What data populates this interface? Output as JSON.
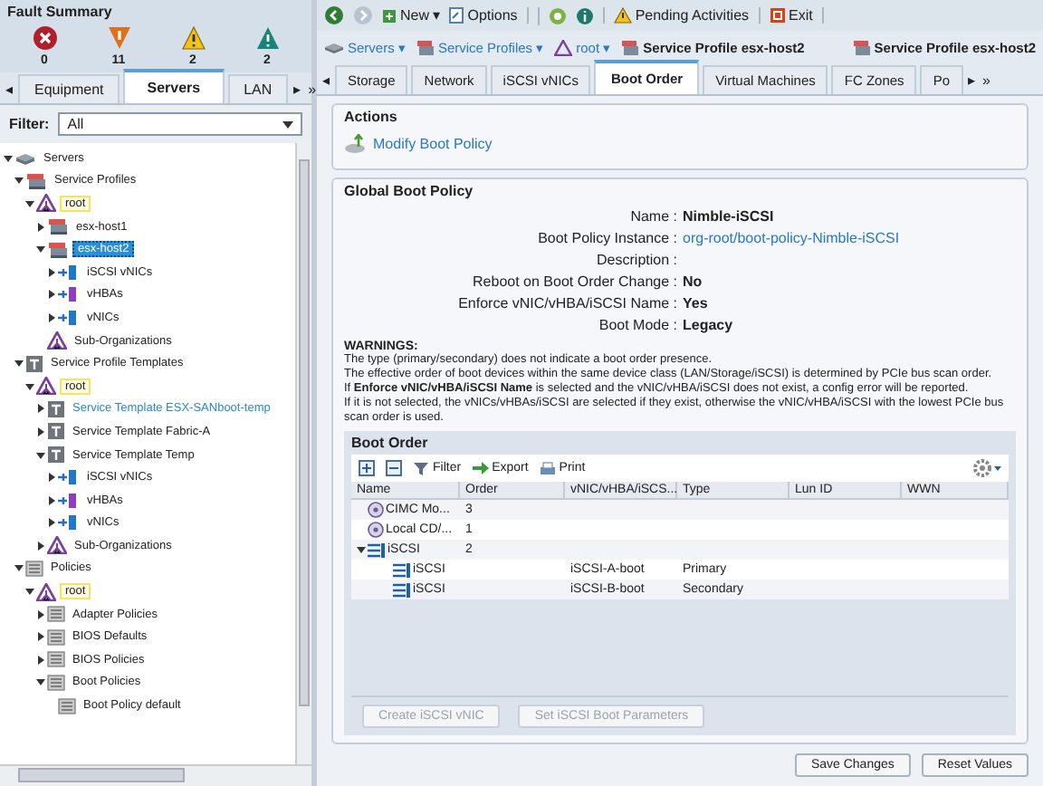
{
  "fault_summary": {
    "title": "Fault Summary",
    "faults": [
      {
        "kind": "critical",
        "count": "0"
      },
      {
        "kind": "major",
        "count": "11"
      },
      {
        "kind": "minor",
        "count": "2"
      },
      {
        "kind": "warning",
        "count": "2"
      }
    ]
  },
  "nav_tabs": {
    "prev": "◂",
    "next": "▸",
    "more": "»",
    "tabs": [
      {
        "label": "Equipment",
        "selected": false
      },
      {
        "label": "Servers",
        "selected": true
      },
      {
        "label": "LAN",
        "selected": false
      }
    ]
  },
  "filter": {
    "label": "Filter:",
    "value": "All"
  },
  "tree": [
    {
      "label": "Servers",
      "kind": "server",
      "expanded": true,
      "selected": false,
      "hovered": false,
      "children": [
        {
          "label": "Service Profiles",
          "kind": "profiles",
          "expanded": true,
          "selected": false,
          "hovered": false,
          "children": [
            {
              "label": "root",
              "kind": "root",
              "expanded": true,
              "selected": false,
              "hovered": false,
              "children": [
                {
                  "label": "esx-host1",
                  "kind": "host",
                  "expanded": false,
                  "selected": false,
                  "hovered": false
                },
                {
                  "label": "esx-host2",
                  "kind": "host",
                  "expanded": true,
                  "selected": true,
                  "hovered": false,
                  "children": [
                    {
                      "label": "iSCSI vNICs",
                      "kind": "vnic",
                      "expanded": false,
                      "selected": false,
                      "hovered": false
                    },
                    {
                      "label": "vHBAs",
                      "kind": "vhba",
                      "expanded": false,
                      "selected": false,
                      "hovered": false
                    },
                    {
                      "label": "vNICs",
                      "kind": "vnic",
                      "expanded": false,
                      "selected": false,
                      "hovered": false
                    }
                  ]
                },
                {
                  "label": "Sub-Organizations",
                  "kind": "org",
                  "selected": false,
                  "hovered": false
                }
              ]
            }
          ]
        },
        {
          "label": "Service Profile Templates",
          "kind": "template",
          "expanded": true,
          "selected": false,
          "hovered": false,
          "children": [
            {
              "label": "root",
              "kind": "root",
              "expanded": true,
              "selected": false,
              "hovered": false,
              "children": [
                {
                  "label": "Service Template ESX-SANboot-temp",
                  "kind": "template",
                  "expanded": false,
                  "selected": false,
                  "hovered": true
                },
                {
                  "label": "Service Template Fabric-A",
                  "kind": "template",
                  "expanded": false,
                  "selected": false,
                  "hovered": false
                },
                {
                  "label": "Service Template Temp",
                  "kind": "template",
                  "expanded": true,
                  "selected": false,
                  "hovered": false,
                  "children": [
                    {
                      "label": "iSCSI vNICs",
                      "kind": "vnic",
                      "expanded": false,
                      "selected": false,
                      "hovered": false
                    },
                    {
                      "label": "vHBAs",
                      "kind": "vhba",
                      "expanded": false,
                      "selected": false,
                      "hovered": false
                    },
                    {
                      "label": "vNICs",
                      "kind": "vnic",
                      "expanded": false,
                      "selected": false,
                      "hovered": false
                    }
                  ]
                },
                {
                  "label": "Sub-Organizations",
                  "kind": "org",
                  "expanded": false,
                  "selected": false,
                  "hovered": false
                }
              ]
            }
          ]
        },
        {
          "label": "Policies",
          "kind": "policy",
          "expanded": true,
          "selected": false,
          "hovered": false,
          "children": [
            {
              "label": "root",
              "kind": "root",
              "expanded": true,
              "selected": false,
              "hovered": false,
              "children": [
                {
                  "label": "Adapter Policies",
                  "kind": "policy",
                  "expanded": false,
                  "selected": false,
                  "hovered": false
                },
                {
                  "label": "BIOS Defaults",
                  "kind": "policy",
                  "expanded": false,
                  "selected": false,
                  "hovered": false
                },
                {
                  "label": "BIOS Policies",
                  "kind": "policy",
                  "expanded": false,
                  "selected": false,
                  "hovered": false
                },
                {
                  "label": "Boot Policies",
                  "kind": "policy",
                  "expanded": true,
                  "selected": false,
                  "hovered": false,
                  "children": [
                    {
                      "label": "Boot Policy default",
                      "kind": "policy",
                      "selected": false,
                      "hovered": false
                    }
                  ]
                }
              ]
            }
          ]
        }
      ]
    }
  ],
  "toolbar": [
    {
      "kind": "back"
    },
    {
      "kind": "forward"
    },
    {
      "kind": "new",
      "label": "New ▾"
    },
    {
      "kind": "options",
      "label": "Options"
    },
    {
      "kind": "help"
    },
    {
      "kind": "info"
    },
    {
      "kind": "pending",
      "label": "Pending Activities"
    },
    {
      "kind": "exit",
      "label": "Exit"
    }
  ],
  "breadcrumb": [
    {
      "kind": "server",
      "label": "Servers ▾"
    },
    {
      "kind": "profiles",
      "label": "Service Profiles ▾"
    },
    {
      "kind": "org",
      "label": "root ▾"
    },
    {
      "kind": "profiles",
      "label": "Service Profile esx-host2"
    }
  ],
  "header_title": "Service Profile esx-host2",
  "content_tabs": {
    "prev": "◂",
    "next": "▸",
    "more": "»",
    "tabs": [
      {
        "label": "Storage",
        "selected": false
      },
      {
        "label": "Network",
        "selected": false
      },
      {
        "label": "iSCSI vNICs",
        "selected": false
      },
      {
        "label": "Boot Order",
        "selected": true
      },
      {
        "label": "Virtual Machines",
        "selected": false
      },
      {
        "label": "FC Zones",
        "selected": false
      },
      {
        "label": "Po",
        "selected": false
      }
    ]
  },
  "actions": {
    "title": "Actions",
    "items": [
      "Modify Boot Policy"
    ]
  },
  "global_boot_policy": {
    "title": "Global Boot Policy",
    "properties": [
      {
        "label": "Name :",
        "value": "Nimble-iSCSI",
        "kind": "bold"
      },
      {
        "label": "Boot Policy Instance :",
        "value": "org-root/boot-policy-Nimble-iSCSI",
        "kind": "link"
      },
      {
        "label": "Description :",
        "kind": "empty"
      },
      {
        "label": "Reboot on Boot Order Change :",
        "value": "No",
        "kind": "bold"
      },
      {
        "label": "Enforce vNIC/vHBA/iSCSI Name :",
        "value": "Yes",
        "kind": "bold"
      },
      {
        "label": "Boot Mode :",
        "value": "Legacy",
        "kind": "bold"
      }
    ],
    "warnings_title": "WARNINGS:",
    "warnings": [
      "The type (primary/secondary) does not indicate a boot order presence.",
      "The effective order of boot devices within the same device class (LAN/Storage/iSCSI) is determined by PCIe bus scan order.",
      "If **Enforce vNIC/vHBA/iSCSI Name** is selected and the vNIC/vHBA/iSCSI does not exist, a config error will be reported.",
      "If it is not selected, the vNICs/vHBAs/iSCSI are selected if they exist, otherwise the vNIC/vHBA/iSCSI with the lowest PCIe bus scan order is used."
    ]
  },
  "boot_order": {
    "title": "Boot Order",
    "tools": [
      {
        "kind": "add"
      },
      {
        "kind": "remove"
      },
      {
        "kind": "filter",
        "label": "Filter"
      },
      {
        "kind": "export",
        "label": "Export"
      },
      {
        "kind": "print",
        "label": "Print"
      }
    ],
    "columns": [
      "Name",
      "Order",
      "vNIC/vHBA/iSCS...",
      "Type",
      "Lun ID",
      "WWN"
    ],
    "rows": [
      {
        "kind": "cimc",
        "cells": [
          "CIMC Mo...",
          "3",
          "",
          "",
          "",
          ""
        ]
      },
      {
        "kind": "cd",
        "cells": [
          "Local CD/...",
          "1",
          "",
          "",
          "",
          ""
        ]
      },
      {
        "kind": "iscsi",
        "expanded": true,
        "cells": [
          "iSCSI",
          "2",
          "",
          "",
          "",
          ""
        ],
        "children": [
          {
            "kind": "iscsi",
            "cells": [
              "iSCSI",
              "",
              "iSCSI-A-boot",
              "Primary",
              "",
              ""
            ]
          },
          {
            "kind": "iscsi",
            "cells": [
              "iSCSI",
              "",
              "iSCSI-B-boot",
              "Secondary",
              "",
              ""
            ]
          }
        ]
      }
    ],
    "buttons": [
      {
        "label": "Create iSCSI vNIC",
        "disabled": true
      },
      {
        "label": "Set iSCSI Boot Parameters",
        "disabled": true
      }
    ]
  },
  "footer_buttons": [
    "Save Changes",
    "Reset Values"
  ]
}
